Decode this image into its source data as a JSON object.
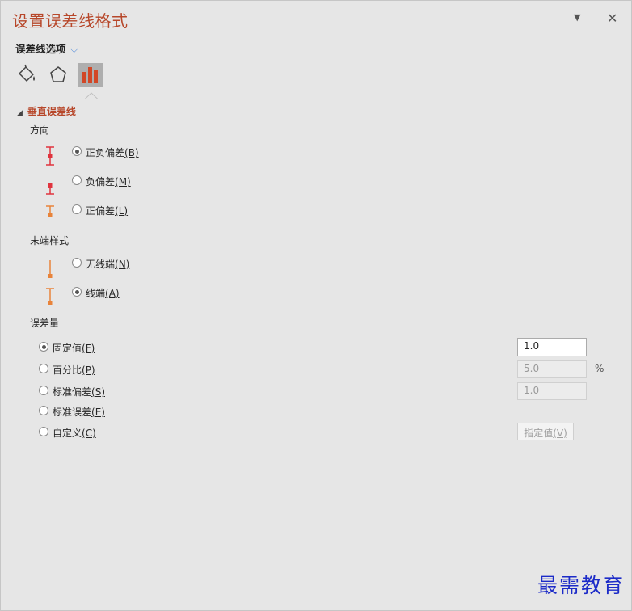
{
  "pane": {
    "title": "设置误差线格式",
    "menu_icon": "chevron-down-icon",
    "close_icon": "close-icon",
    "options_dropdown": "误差线选项"
  },
  "tabs": [
    {
      "icon": "fill-bucket-icon",
      "active": false
    },
    {
      "icon": "pentagon-icon",
      "active": false
    },
    {
      "icon": "bar-chart-icon",
      "active": true
    }
  ],
  "section": {
    "title": "垂直误差线",
    "direction_label": "方向",
    "direction": [
      {
        "label": "正负偏差(B)",
        "checked": true,
        "color": "#e0343e"
      },
      {
        "label": "负偏差(M)",
        "checked": false,
        "color": "#e0343e"
      },
      {
        "label": "正偏差(L)",
        "checked": false,
        "color": "#e8833a"
      }
    ],
    "end_style_label": "末端样式",
    "end_style": [
      {
        "label": "无线端(N)",
        "checked": false,
        "color": "#e8833a"
      },
      {
        "label": "线端(A)",
        "checked": true,
        "color": "#e8833a"
      }
    ],
    "amount_label": "误差量",
    "amount": [
      {
        "label": "固定值(F)",
        "checked": true,
        "value": "1.0"
      },
      {
        "label": "百分比(P)",
        "checked": false,
        "value": "5.0",
        "unit": "%"
      },
      {
        "label": "标准偏差(S)",
        "checked": false,
        "value": "1.0"
      },
      {
        "label": "标准误差(E)",
        "checked": false
      },
      {
        "label": "自定义(C)",
        "checked": false,
        "button": "指定值(V)"
      }
    ]
  },
  "watermark": "最需教育",
  "colors": {
    "accent": "#b7472a",
    "dropdown": "#3b7dd8",
    "watermark": "#1c2bc8"
  }
}
